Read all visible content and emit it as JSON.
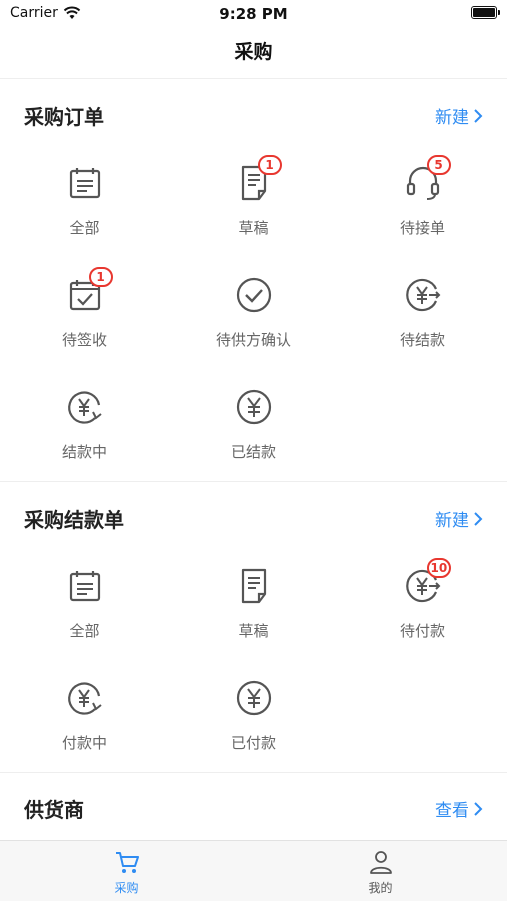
{
  "status_bar": {
    "carrier": "Carrier",
    "time": "9:28 PM"
  },
  "nav": {
    "title": "采购"
  },
  "purchase_orders": {
    "title": "采购订单",
    "action": "新建",
    "items": [
      {
        "label": "全部",
        "icon": "calendar-list-icon",
        "badge": null
      },
      {
        "label": "草稿",
        "icon": "document-icon",
        "badge": "1"
      },
      {
        "label": "待接单",
        "icon": "headset-icon",
        "badge": "5"
      },
      {
        "label": "待签收",
        "icon": "checkbox-calendar-icon",
        "badge": "1"
      },
      {
        "label": "待供方确认",
        "icon": "check-circle-icon",
        "badge": null
      },
      {
        "label": "待结款",
        "icon": "yen-arrow-icon",
        "badge": null
      },
      {
        "label": "结款中",
        "icon": "yen-refresh-icon",
        "badge": null
      },
      {
        "label": "已结款",
        "icon": "yen-circle-icon",
        "badge": null
      }
    ]
  },
  "settlement_orders": {
    "title": "采购结款单",
    "action": "新建",
    "items": [
      {
        "label": "全部",
        "icon": "calendar-list-icon",
        "badge": null
      },
      {
        "label": "草稿",
        "icon": "document-icon",
        "badge": null
      },
      {
        "label": "待付款",
        "icon": "yen-arrow-icon",
        "badge": "10"
      },
      {
        "label": "付款中",
        "icon": "yen-refresh-icon",
        "badge": null
      },
      {
        "label": "已付款",
        "icon": "yen-circle-icon",
        "badge": null
      }
    ]
  },
  "suppliers": {
    "title": "供货商",
    "action": "查看"
  },
  "tab_bar": {
    "tabs": [
      {
        "label": "采购",
        "icon": "cart-icon",
        "active": true
      },
      {
        "label": "我的",
        "icon": "user-icon",
        "active": false
      }
    ]
  },
  "colors": {
    "accent": "#2f8cf2",
    "badge": "#e8372f",
    "icon": "#555555"
  }
}
